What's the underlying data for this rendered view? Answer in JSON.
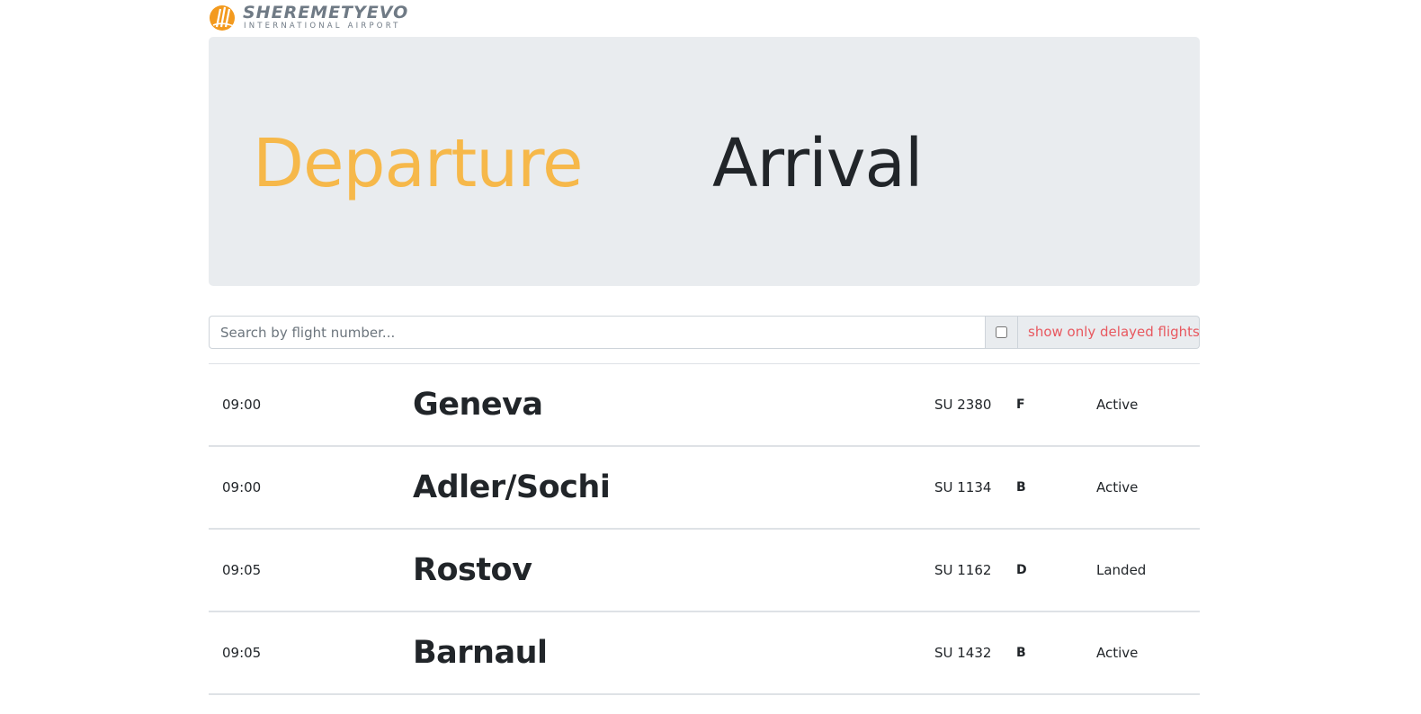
{
  "logo": {
    "title": "SHEREMETYEVO",
    "subtitle": "INTERNATIONAL AIRPORT"
  },
  "tabs": {
    "departure": "Departure",
    "arrival": "Arrival",
    "active": "departure"
  },
  "search": {
    "placeholder": "Search by flight number...",
    "value": "",
    "delayed_label": "show only delayed flights",
    "delayed_checked": false
  },
  "flights": [
    {
      "time": "09:00",
      "city": "Geneva",
      "flight": "SU 2380",
      "terminal": "F",
      "status": "Active"
    },
    {
      "time": "09:00",
      "city": "Adler/Sochi",
      "flight": "SU 1134",
      "terminal": "B",
      "status": "Active"
    },
    {
      "time": "09:05",
      "city": "Rostov",
      "flight": "SU 1162",
      "terminal": "D",
      "status": "Landed"
    },
    {
      "time": "09:05",
      "city": "Barnaul",
      "flight": "SU 1432",
      "terminal": "B",
      "status": "Active"
    }
  ],
  "colors": {
    "accent": "#f6b84a",
    "delayed_text": "#e8585f",
    "jumbotron_bg": "#e9ecef"
  }
}
